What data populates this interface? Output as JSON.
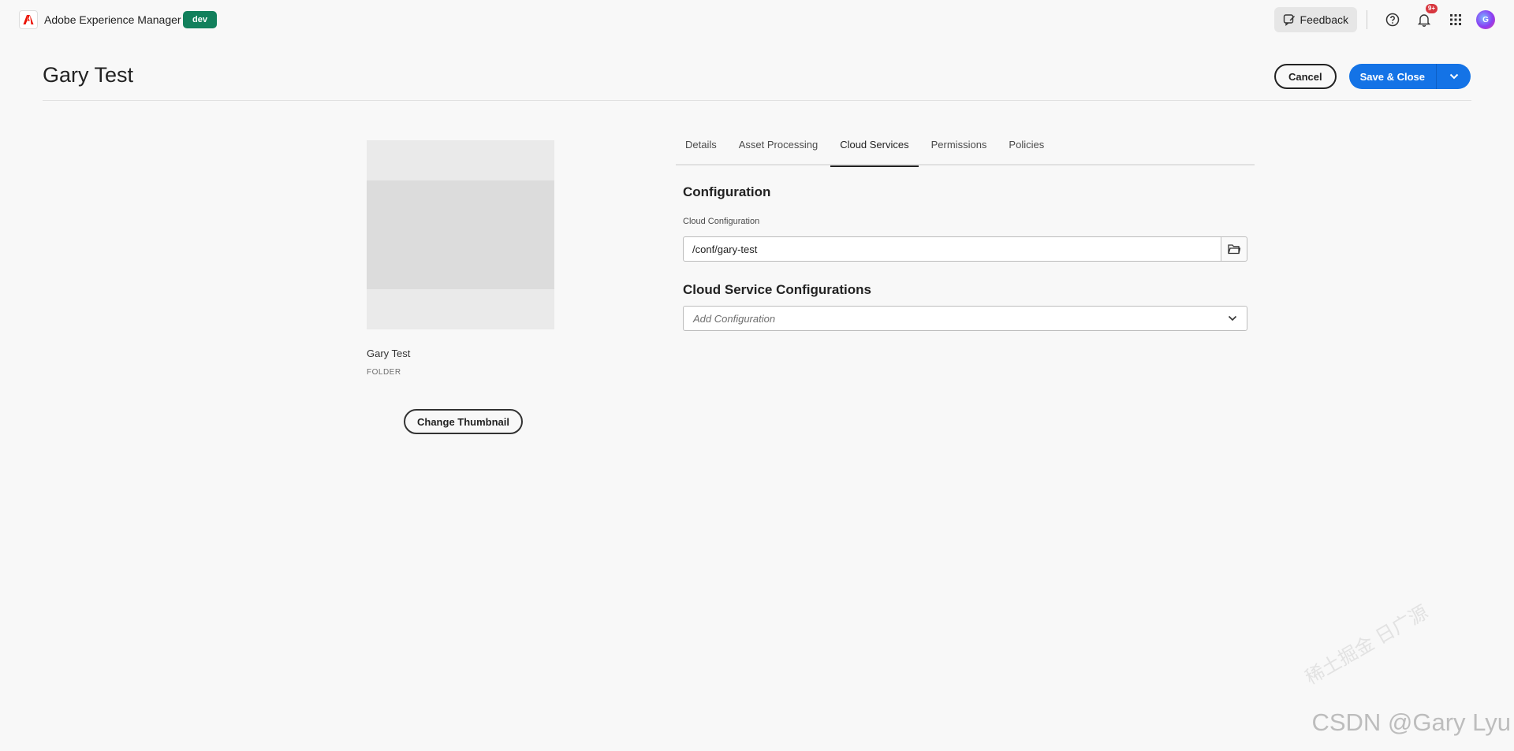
{
  "app": {
    "title": "Adobe Experience Manager",
    "env_badge": "dev",
    "feedback_label": "Feedback",
    "notification_count": "9+",
    "avatar_initials": "G"
  },
  "page": {
    "title": "Gary Test",
    "cancel_label": "Cancel",
    "save_label": "Save & Close"
  },
  "thumbnail": {
    "name": "Gary Test",
    "type": "FOLDER",
    "change_label": "Change Thumbnail"
  },
  "tabs": [
    {
      "label": "Details",
      "active": false
    },
    {
      "label": "Asset Processing",
      "active": false
    },
    {
      "label": "Cloud Services",
      "active": true
    },
    {
      "label": "Permissions",
      "active": false
    },
    {
      "label": "Policies",
      "active": false
    }
  ],
  "form": {
    "configuration_heading": "Configuration",
    "cloud_config_label": "Cloud Configuration",
    "cloud_config_value": "/conf/gary-test",
    "cloud_service_heading": "Cloud Service Configurations",
    "add_config_placeholder": "Add Configuration"
  },
  "watermark": {
    "chinese": "稀土掘金 日广源",
    "csdn": "CSDN @Gary Lyu"
  },
  "colors": {
    "accent": "#1473e6",
    "env_badge": "#12805c",
    "notification": "#d7373f"
  },
  "icons": [
    "adobe-logo-icon",
    "feedback-icon",
    "help-icon",
    "bell-icon",
    "apps-grid-icon",
    "chevron-down-icon",
    "folder-icon"
  ]
}
